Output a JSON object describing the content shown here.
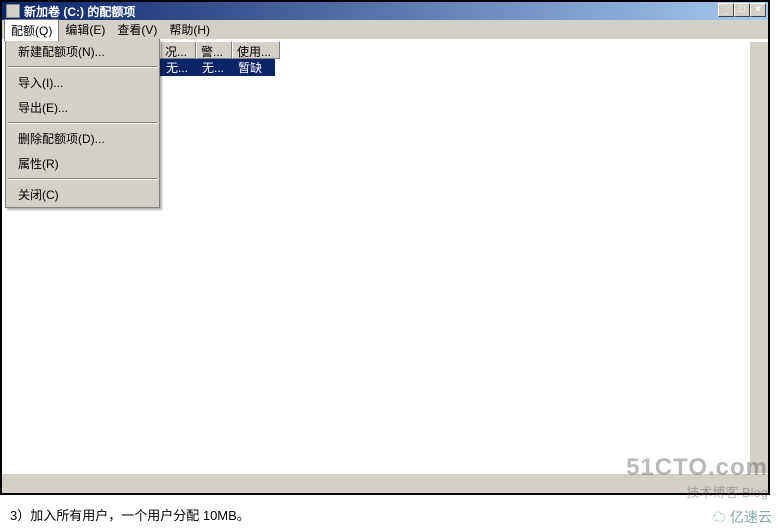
{
  "window": {
    "title": "新加卷 (C:) 的配额项"
  },
  "title_controls": {
    "min": "_",
    "max": "□",
    "close": "×"
  },
  "menubar": {
    "quota": "配额(Q)",
    "edit": "编辑(E)",
    "view": "查看(V)",
    "help": "帮助(H)"
  },
  "dropdown": {
    "new_quota": "新建配额项(N)...",
    "import": "导入(I)...",
    "export": "导出(E)...",
    "delete_quota": "删除配额项(D)...",
    "properties": "属性(R)",
    "close": "关闭(C)"
  },
  "columns": {
    "c1": "况...",
    "c2": "警...",
    "c3": "使用..."
  },
  "row": {
    "v1": "无...",
    "v2": "无...",
    "v3": "暂缺"
  },
  "caption": "3）加入所有用户，一个用户分配 10MB。",
  "watermark": {
    "line1": "51CTO.com",
    "line2": "技术博客  Blog",
    "line3": "亿速云"
  }
}
